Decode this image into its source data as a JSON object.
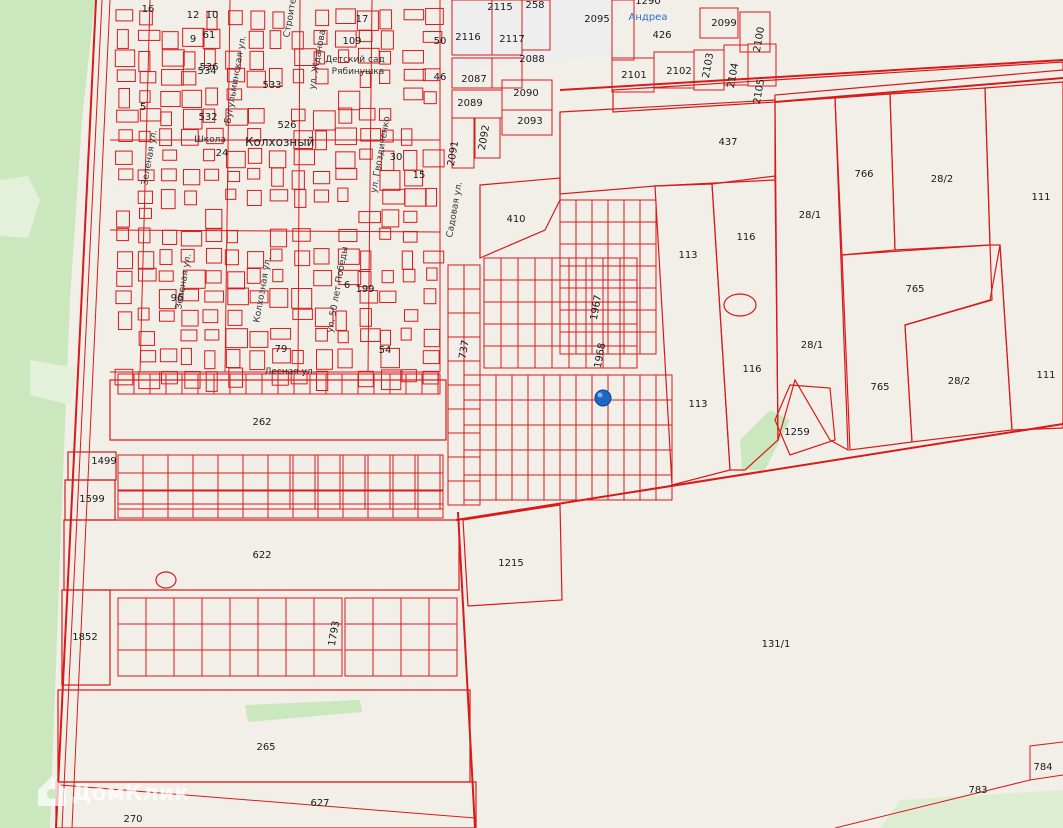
{
  "map": {
    "village_name": "Колхозный",
    "poi_labels": [
      "Школа",
      "Детский сад",
      "Рябинушка",
      "Андреа"
    ],
    "parcel_labels": [
      "16",
      "9",
      "12",
      "61",
      "10",
      "17",
      "109",
      "536",
      "534",
      "533",
      "532",
      "526",
      "5",
      "24",
      "30",
      "15",
      "50",
      "46",
      "2116",
      "2115",
      "258",
      "2095",
      "1290",
      "426",
      "2099",
      "2100",
      "2087",
      "2117",
      "2088",
      "2101",
      "2102",
      "2103",
      "2104",
      "2105",
      "2089",
      "2090",
      "2093",
      "2092",
      "2091",
      "437",
      "410",
      "766",
      "28/2",
      "111",
      "116",
      "28/1",
      "113",
      "765",
      "1967",
      "1968",
      "737",
      "96",
      "79",
      "54",
      "199",
      "6",
      "262",
      "1259",
      "1499",
      "1599",
      "622",
      "1215",
      "131/1",
      "1852",
      "1793",
      "265",
      "627",
      "270",
      "784",
      "783"
    ],
    "street_labels": [
      "ул. Жданова",
      "Зеленая ул.",
      "Бугульминская ул.",
      "ул. Гвоздиченко",
      "Лесная ул.",
      "Колхозная ул.",
      "ул. 50 лет Победы",
      "Зеленая ул.",
      "Строителей",
      "Садовая ул."
    ],
    "watermark": "ДомКлик",
    "colors": {
      "background": "#f2efe9",
      "parcel_line": "#d81a1a",
      "forest": "#cbe7bd",
      "marker": "#1f66c9",
      "poi_text": "#2a6fd6"
    }
  }
}
